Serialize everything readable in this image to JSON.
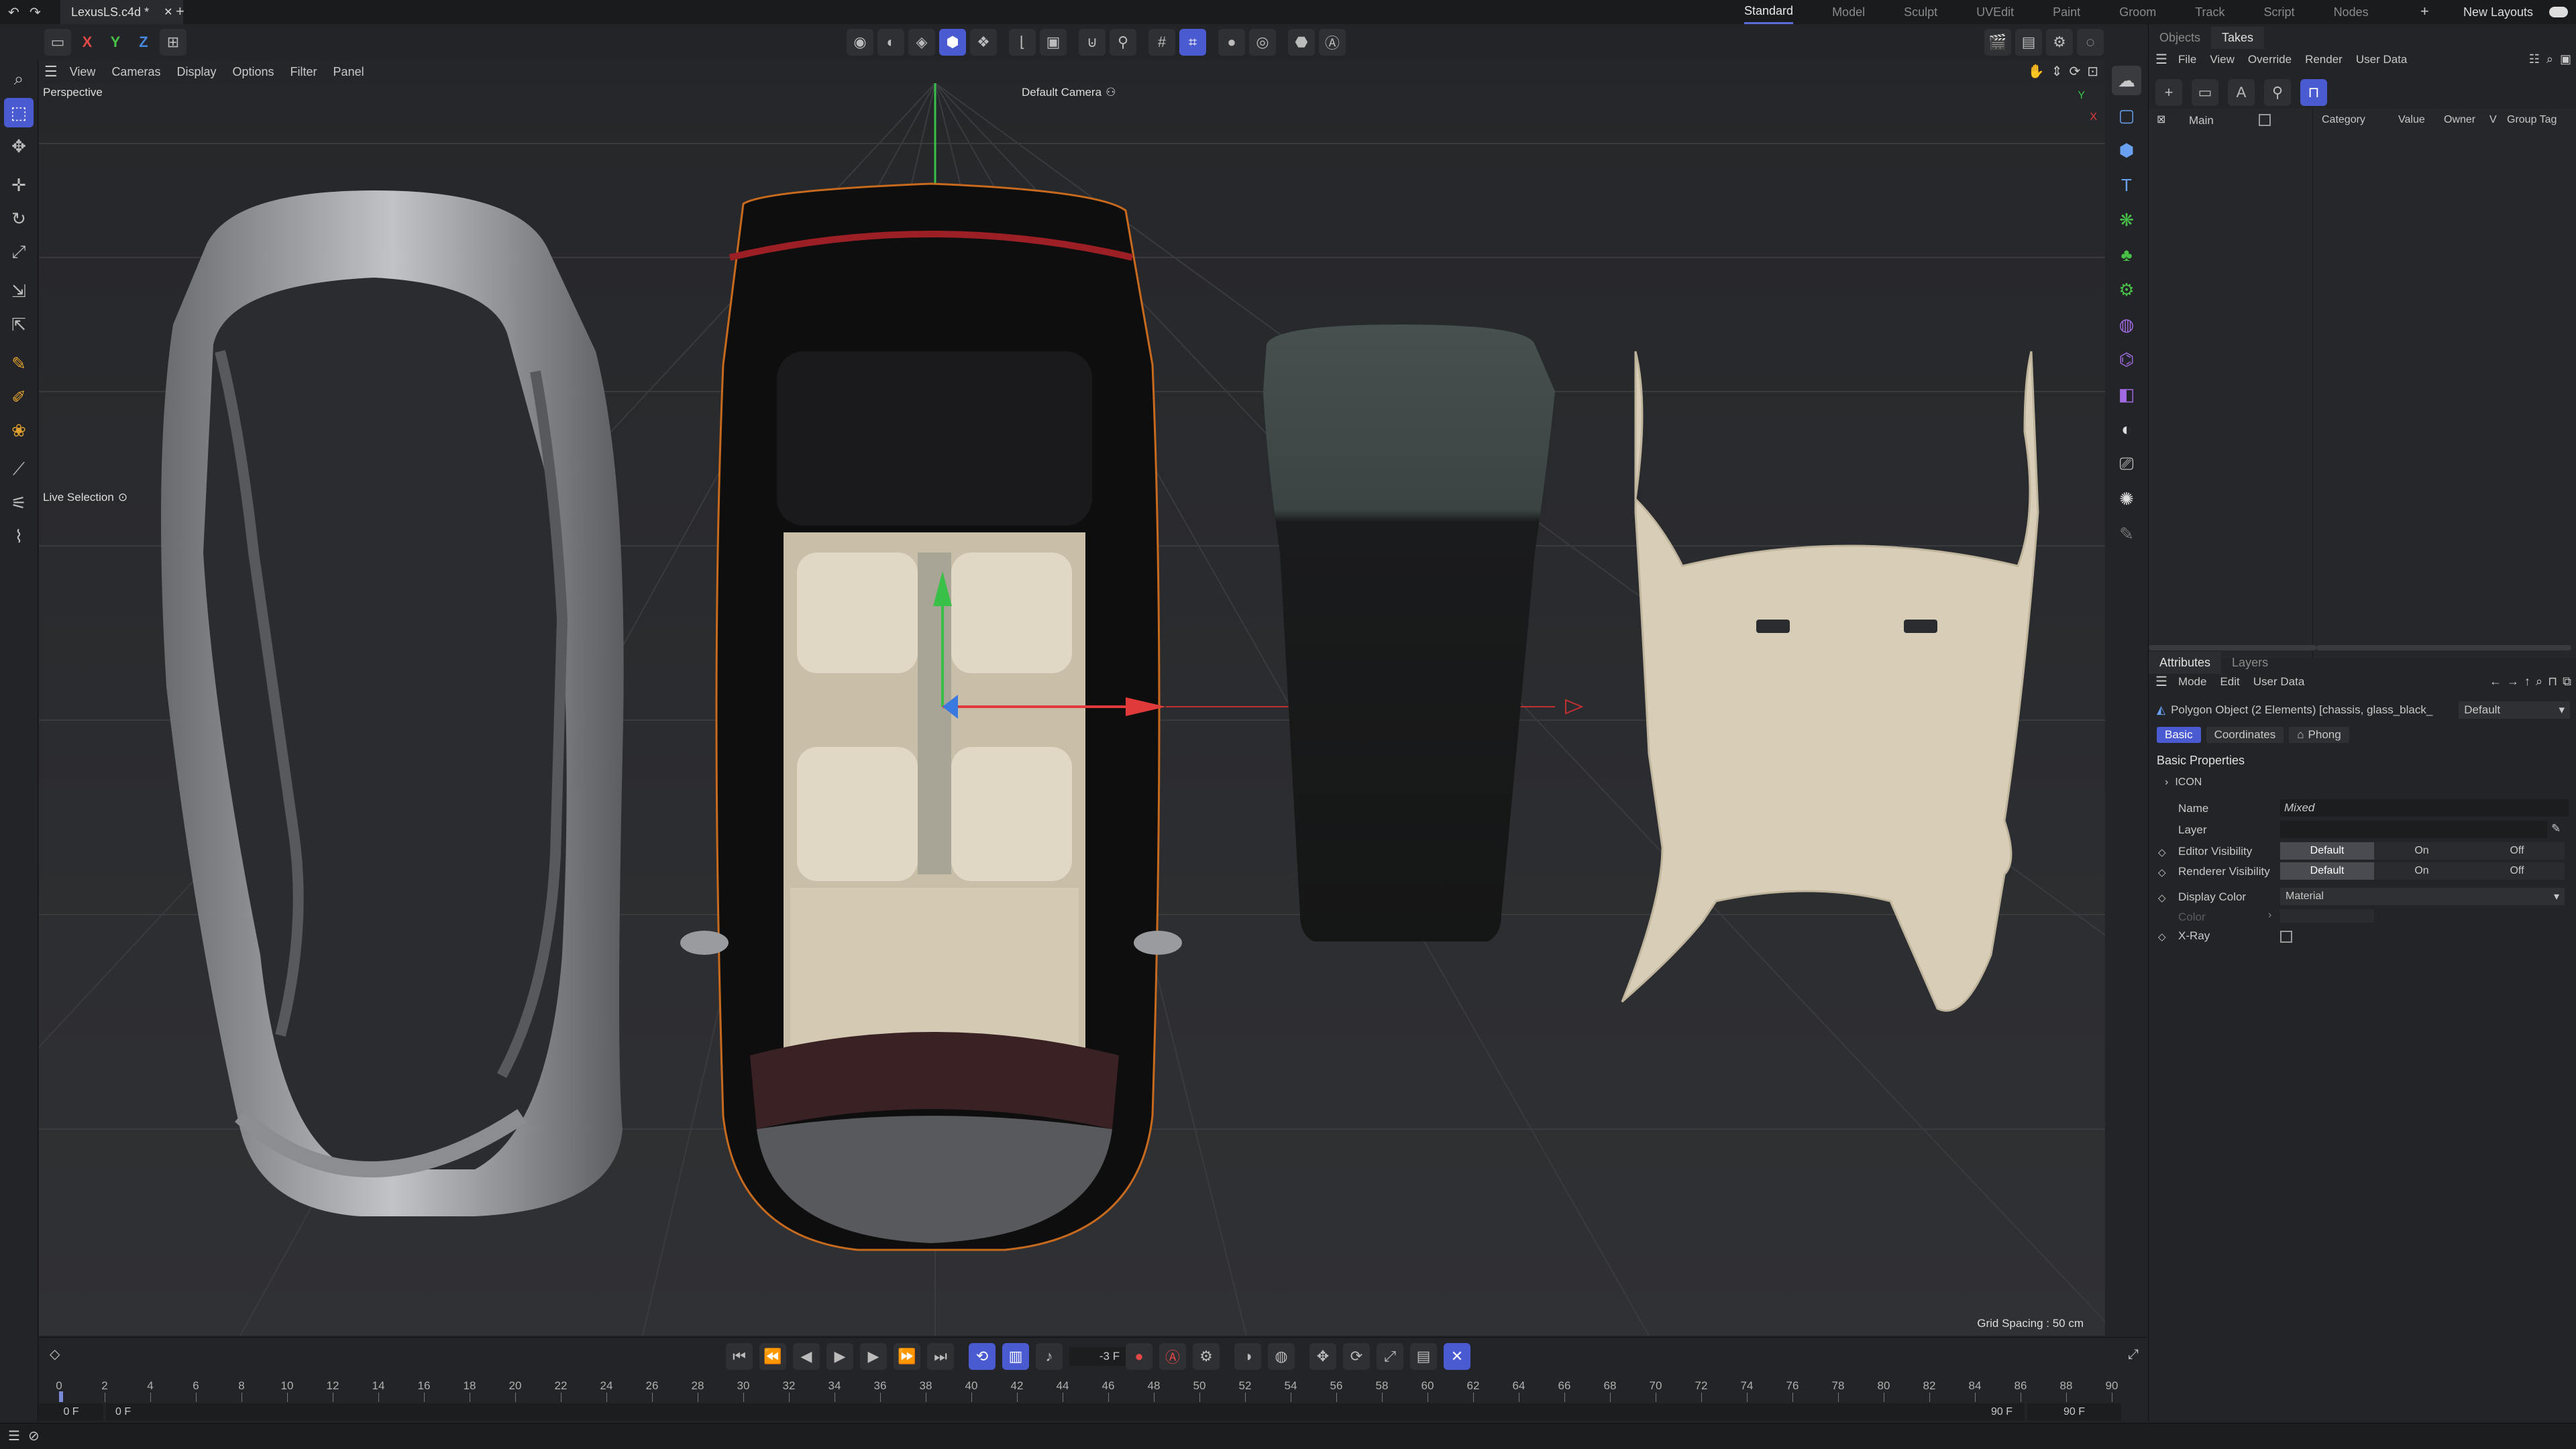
{
  "titlebar": {
    "doc_tab": "LexusLS.c4d *",
    "layouts": [
      "Standard",
      "Model",
      "Sculpt",
      "UVEdit",
      "Paint",
      "Groom",
      "Track",
      "Script",
      "Nodes"
    ],
    "active_layout": "Standard",
    "new_layouts": "New Layouts"
  },
  "axes": {
    "x": "X",
    "y": "Y",
    "z": "Z"
  },
  "viewport": {
    "menu": [
      "View",
      "Cameras",
      "Display",
      "Options",
      "Filter",
      "Panel"
    ],
    "projection": "Perspective",
    "camera": "Default Camera",
    "live_selection": "Live Selection",
    "grid_spacing": "Grid Spacing : 50 cm"
  },
  "objects_panel": {
    "tabs": [
      "Objects",
      "Takes"
    ],
    "active_tab": "Takes",
    "menu": [
      "File",
      "View",
      "Override",
      "Render",
      "User Data"
    ],
    "take_main": "Main",
    "columns": [
      "Category",
      "Value",
      "Owner",
      "V",
      "Group Tag"
    ]
  },
  "attributes_panel": {
    "tabs": [
      "Attributes",
      "Layers"
    ],
    "menu": [
      "Mode",
      "Edit",
      "User Data"
    ],
    "object_title": "Polygon Object (2 Elements) [chassis, glass_black_",
    "preset": "Default",
    "subtabs": [
      "Basic",
      "Coordinates",
      "Phong"
    ],
    "section_title": "Basic Properties",
    "icon_group": "ICON",
    "name_label": "Name",
    "name_value": "Mixed",
    "layer_label": "Layer",
    "editor_vis_label": "Editor Visibility",
    "renderer_vis_label": "Renderer Visibility",
    "vis_options": [
      "Default",
      "On",
      "Off"
    ],
    "display_color_label": "Display Color",
    "display_color_value": "Material",
    "color_label": "Color",
    "xray_label": "X-Ray"
  },
  "timeline": {
    "current_frame": "-3 F",
    "start_field": "0 F",
    "start_field2": "0 F",
    "end_field": "90 F",
    "end_field2": "90 F",
    "ticks": [
      "0",
      "2",
      "4",
      "6",
      "8",
      "10",
      "12",
      "14",
      "16",
      "18",
      "20",
      "22",
      "24",
      "26",
      "28",
      "30",
      "32",
      "34",
      "36",
      "38",
      "40",
      "42",
      "44",
      "46",
      "48",
      "50",
      "52",
      "54",
      "56",
      "58",
      "60",
      "62",
      "64",
      "66",
      "68",
      "70",
      "72",
      "74",
      "76",
      "78",
      "80",
      "82",
      "84",
      "86",
      "88",
      "90"
    ]
  },
  "colors": {
    "accent": "#4a5ad0",
    "interior_beige": "#d8cdb6",
    "axis_x": "#e03a3a",
    "axis_y": "#38c048",
    "axis_z": "#3a7ae0"
  }
}
